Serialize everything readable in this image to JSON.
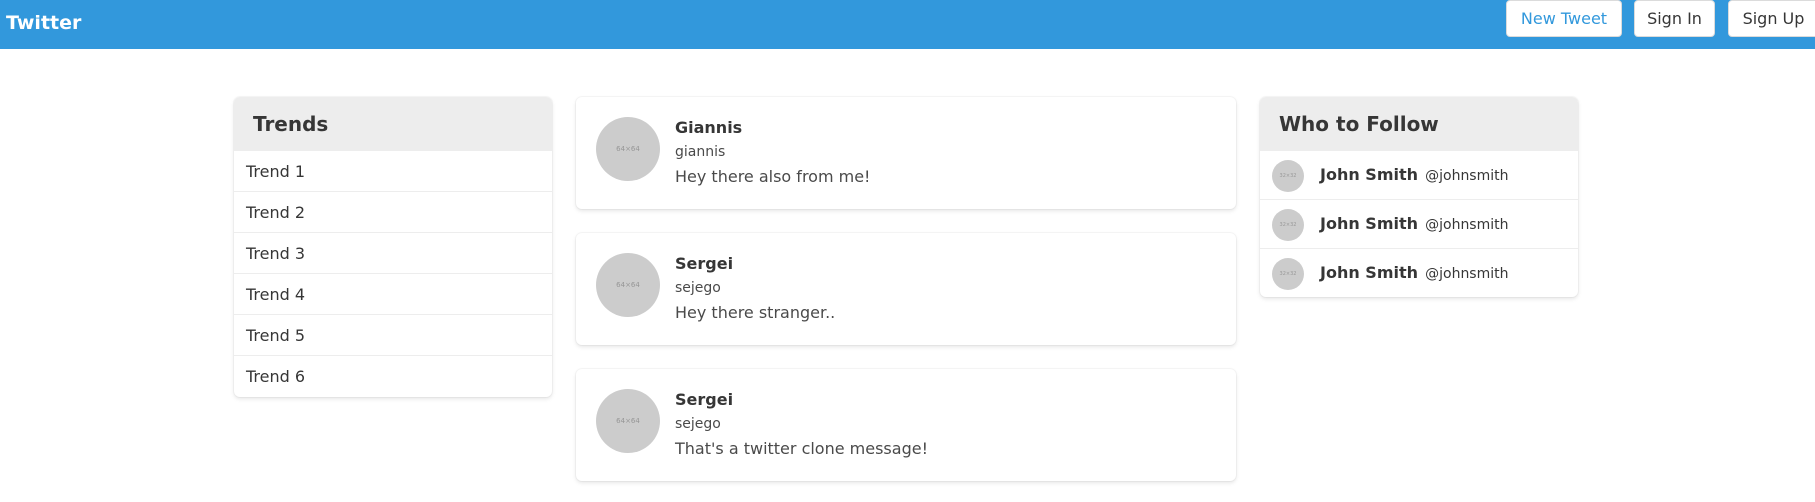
{
  "navbar": {
    "brand": "Twitter",
    "new_tweet": "New Tweet",
    "sign_in": "Sign In",
    "sign_up": "Sign Up",
    "accent_color": "#3298dc"
  },
  "trends": {
    "title": "Trends",
    "items": [
      "Trend 1",
      "Trend 2",
      "Trend 3",
      "Trend 4",
      "Trend 5",
      "Trend 6"
    ]
  },
  "tweets": [
    {
      "name": "Giannis",
      "handle": "giannis",
      "text": "Hey there also from me!",
      "avatar_placeholder": "64×64"
    },
    {
      "name": "Sergei",
      "handle": "sejego",
      "text": "Hey there stranger..",
      "avatar_placeholder": "64×64"
    },
    {
      "name": "Sergei",
      "handle": "sejego",
      "text": "That's a twitter clone message!",
      "avatar_placeholder": "64×64"
    }
  ],
  "who_to_follow": {
    "title": "Who to Follow",
    "items": [
      {
        "name": "John Smith",
        "handle": "@johnsmith",
        "avatar_placeholder": "32×32"
      },
      {
        "name": "John Smith",
        "handle": "@johnsmith",
        "avatar_placeholder": "32×32"
      },
      {
        "name": "John Smith",
        "handle": "@johnsmith",
        "avatar_placeholder": "32×32"
      }
    ]
  }
}
